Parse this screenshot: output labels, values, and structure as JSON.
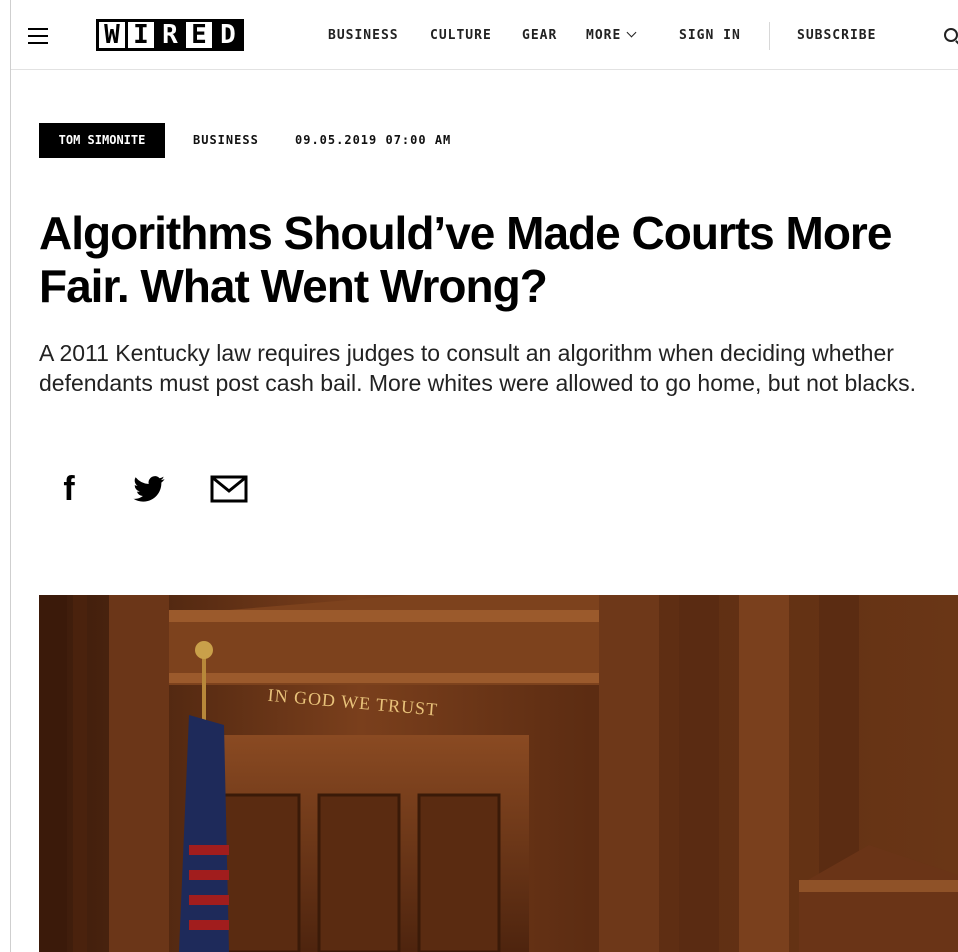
{
  "header": {
    "logo_letters": [
      "W",
      "I",
      "R",
      "E",
      "D"
    ],
    "nav": {
      "business": "BUSINESS",
      "culture": "CULTURE",
      "gear": "GEAR",
      "more": "MORE",
      "sign_in": "SIGN IN",
      "subscribe": "SUBSCRIBE"
    },
    "icons": [
      "hamburger-icon",
      "chevron-down-icon",
      "search-icon"
    ]
  },
  "article": {
    "author": "TOM SIMONITE",
    "section": "BUSINESS",
    "date": "09.05.2019 07:00 AM",
    "headline": "Algorithms Should’ve Made Courts More Fair. What Went Wrong?",
    "dek": "A 2011 Kentucky law requires judges to consult an algorithm when deciding whether defendants must post cash bail. More whites were allowed to go home, but not blacks.",
    "share_icons": [
      "facebook-icon",
      "twitter-icon",
      "email-icon"
    ]
  },
  "hero": {
    "motto": "IN GOD WE TRUST"
  },
  "colors": {
    "text": "#000000",
    "author_badge_bg": "#000000",
    "author_badge_text": "#ffffff",
    "wood": "#5a2d14"
  }
}
